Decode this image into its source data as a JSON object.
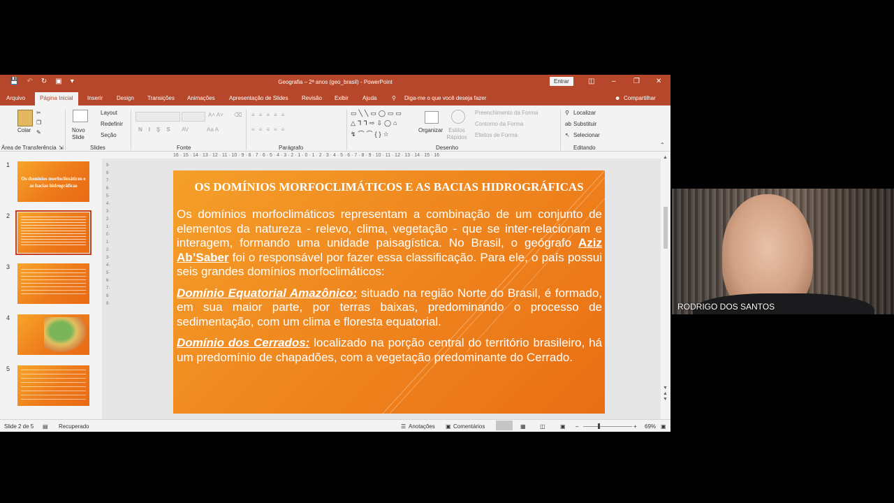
{
  "window": {
    "title": "Geografia – 2ª anos (geo_brasil) - PowerPoint",
    "entrar": "Entrar"
  },
  "menu": {
    "tabs": [
      "Arquivo",
      "Página Inicial",
      "Inserir",
      "Design",
      "Transições",
      "Animações",
      "Apresentação de Slides",
      "Revisão",
      "Exibir",
      "Ajuda"
    ],
    "tell_me": "Diga-me o que você deseja fazer",
    "share": "Compartilhar"
  },
  "ribbon": {
    "colar": "Colar",
    "clipboard_label": "Área de Transferência",
    "novo_slide": "Novo Slide",
    "layout": "Layout",
    "redefinir": "Redefinir",
    "secao": "Seção",
    "slides_label": "Slides",
    "fonte_label": "Fonte",
    "paragrafo_label": "Parágrafo",
    "organizar": "Organizar",
    "estilos_rapidos": "Estilos Rápidos",
    "preenchimento": "Preenchimento da Forma",
    "contorno": "Contorno da Forma",
    "efeitos": "Efeitos de Forma",
    "desenho_label": "Desenho",
    "localizar": "Localizar",
    "substituir": "Substituir",
    "selecionar": "Selecionar",
    "editando_label": "Editando"
  },
  "ruler": "16 · 15 · 14 · 13 · 12 · 11 · 10 · 9 · 8 · 7 · 6 · 5 · 4 · 3 · 2 · 1 · 0 · 1 · 2 · 3 · 4 · 5 · 6 · 7 · 8 · 9 · 10 · 11 · 12 · 13 · 14 · 15 · 16",
  "thumbs": {
    "n1": "1",
    "n2": "2",
    "n3": "3",
    "n4": "4",
    "n5": "5",
    "t1": "Os domínios morfoclimáticos e as bacias hidrográficas"
  },
  "slide": {
    "title": "OS DOMÍNIOS MORFOCLIMÁTICOS E AS BACIAS HIDROGRÁFICAS",
    "p1a": "Os domínios morfoclimáticos representam a combinação de um conjunto de elementos da natureza - relevo, clima, vegetação - que se inter-relacionam e interagem, formando uma unidade paisagística. No Brasil, o geógrafo ",
    "p1b": "Aziz Ab’Saber",
    "p1c": " foi o responsável por fazer essa classificação. Para ele, o país possui seis grandes domínios morfoclimáticos:",
    "p2a": "Domínio Equatorial Amazônico:",
    "p2b": " situado na região Norte do Brasil, é formado, em sua maior parte, por terras baixas, predominando o processo de sedimentação, com um clima e floresta equatorial.",
    "p3a": "Domínio dos Cerrados:",
    "p3b": " localizado na porção central do território brasileiro, há um predomínio de chapadões, com a vegetação predominante do Cerrado."
  },
  "status": {
    "slide": "Slide 2 de 5",
    "recuperado": "Recuperado",
    "anotacoes": "Anotações",
    "comentarios": "Comentários",
    "zoom": "69%"
  },
  "webcam": {
    "name": "RODRIGO DOS SANTOS"
  }
}
